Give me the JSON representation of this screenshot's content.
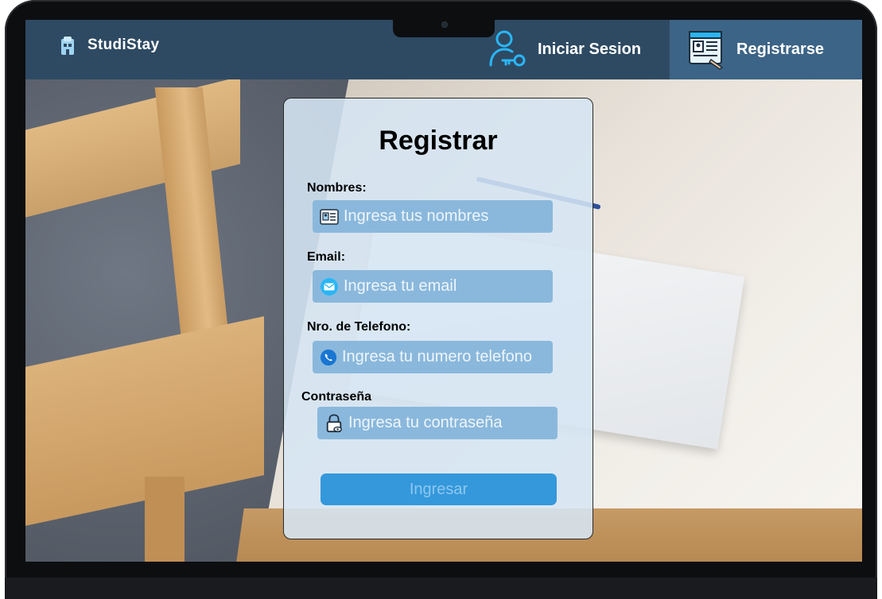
{
  "brand": {
    "name": "StudiStay"
  },
  "nav": {
    "login_label": "Iniciar Sesion",
    "register_label": "Registrarse"
  },
  "form": {
    "title": "Registrar",
    "fields": [
      {
        "label": "Nombres:",
        "placeholder": "Ingresa tus nombres",
        "icon": "id-card-icon"
      },
      {
        "label": "Email:",
        "placeholder": "Ingresa tu email",
        "icon": "envelope-icon"
      },
      {
        "label": "Nro. de Telefono:",
        "placeholder": "Ingresa tu numero telefono",
        "icon": "phone-icon"
      },
      {
        "label": "Contraseña",
        "placeholder": "Ingresa tu contraseña",
        "icon": "lock-icon"
      }
    ],
    "submit_label": "Ingresar"
  },
  "colors": {
    "navbar": "#2e4a63",
    "navbar_active": "#3c6486",
    "field_bg": "#8ab8dc",
    "button_bg": "#3498db",
    "button_text": "#8ec7f0",
    "icon_accent": "#29b6f6"
  }
}
